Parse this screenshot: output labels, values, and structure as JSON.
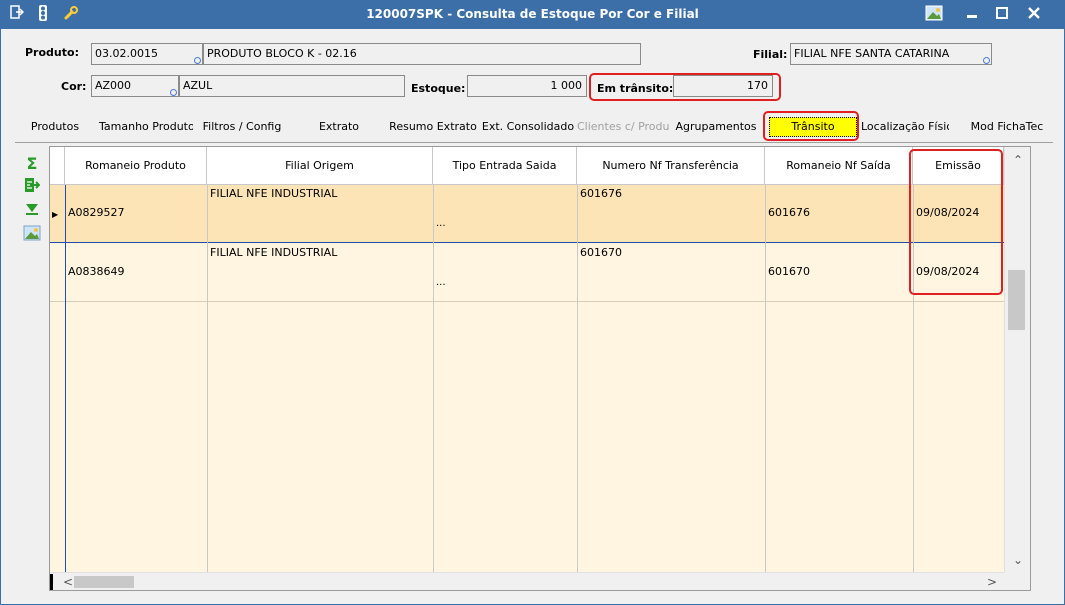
{
  "window": {
    "title": "120007SPK - Consulta de Estoque Por Cor e Filial",
    "accent_color": "#3c6fa8",
    "title_icons": [
      "exit-icon",
      "traffic-light-icon",
      "wrench-icon"
    ],
    "window_buttons": [
      "image-icon",
      "minimize-icon",
      "maximize-icon",
      "close-icon"
    ]
  },
  "header": {
    "produto_label": "Produto:",
    "produto_code": "03.02.0015",
    "produto_desc": "PRODUTO BLOCO K - 02.16",
    "filial_label": "Filial:",
    "filial_value": "FILIAL NFE SANTA CATARINA",
    "cor_label": "Cor:",
    "cor_code": "AZ000",
    "cor_desc": "AZUL",
    "estoque_label": "Estoque:",
    "estoque_value": "1 000",
    "transito_label": "Em trânsito:",
    "transito_value": "170"
  },
  "tabs": [
    {
      "label": "Produtos",
      "state": "normal"
    },
    {
      "label": "Tamanho Produto",
      "state": "normal"
    },
    {
      "label": "Filtros / Config",
      "state": "normal"
    },
    {
      "label": "Extrato",
      "state": "normal"
    },
    {
      "label": "Resumo Extrato",
      "state": "normal"
    },
    {
      "label": "Ext. Consolidado",
      "state": "normal"
    },
    {
      "label": "Clientes c/ Produto",
      "state": "disabled"
    },
    {
      "label": "Agrupamentos",
      "state": "normal"
    },
    {
      "label": "Trânsito",
      "state": "active"
    },
    {
      "label": "Localização Física",
      "state": "normal"
    },
    {
      "label": "Mod FichaTec",
      "state": "normal"
    }
  ],
  "side_icons": [
    "sum-icon",
    "export-icon",
    "expand-down-icon",
    "image-icon"
  ],
  "grid": {
    "columns": [
      "Romaneio Produto",
      "Filial Origem",
      "Tipo Entrada Saida",
      "Numero Nf Transferência",
      "Romaneio Nf Saída",
      "Emissão"
    ],
    "rows": [
      {
        "romaneio": "A0829527",
        "filial_origem": "FILIAL NFE INDUSTRIAL",
        "tipo": "...",
        "numero_nf": "601676",
        "romaneio_nf": "601676",
        "emissao": "09/08/2024",
        "selected": true
      },
      {
        "romaneio": "A0838649",
        "filial_origem": "FILIAL NFE INDUSTRIAL",
        "tipo": "...",
        "numero_nf": "601670",
        "romaneio_nf": "601670",
        "emissao": "09/08/2024",
        "selected": false
      }
    ]
  },
  "highlight_color": "#e02020"
}
